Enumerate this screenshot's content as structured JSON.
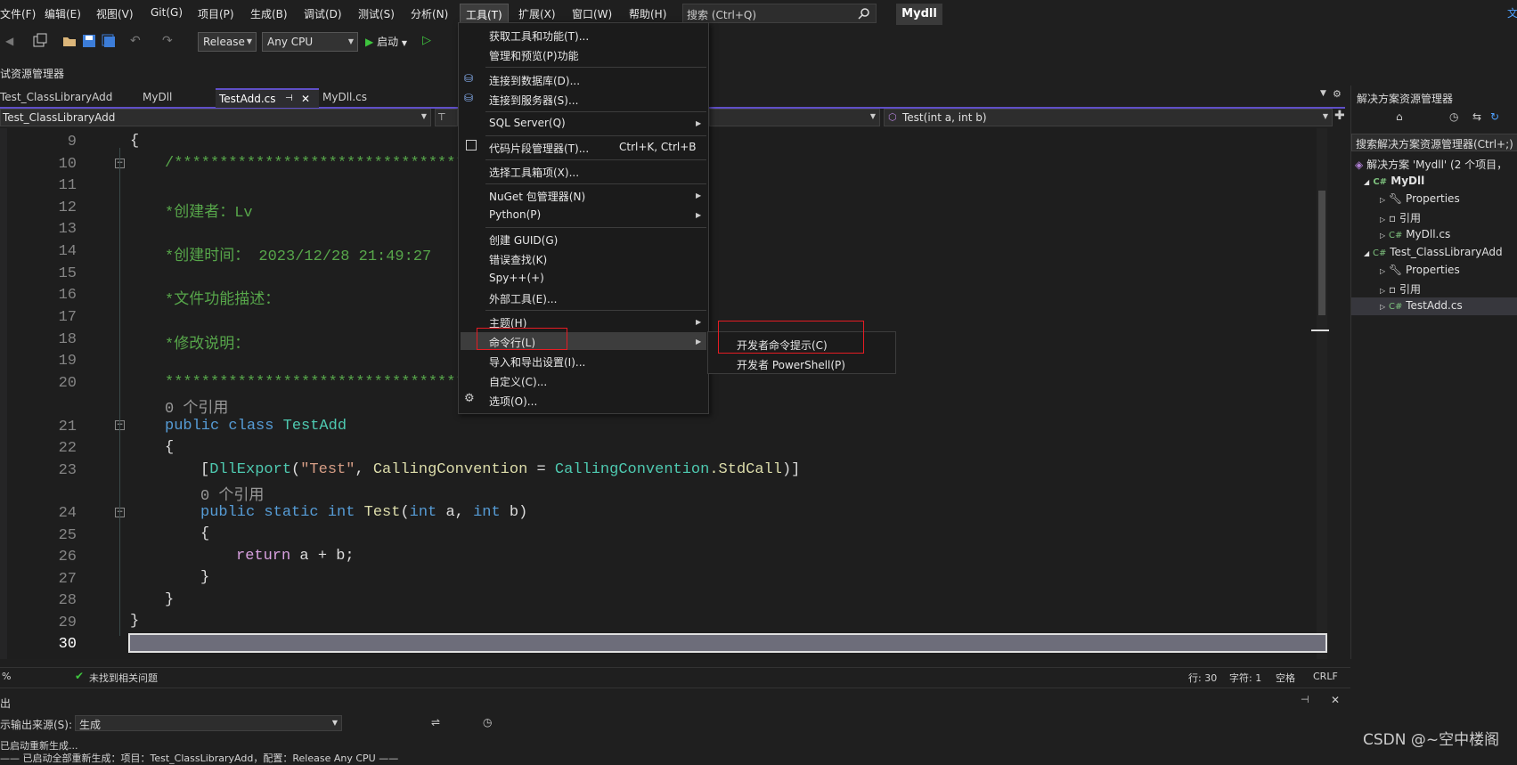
{
  "menubar": {
    "items": [
      "文件(F)",
      "编辑(E)",
      "视图(V)",
      "Git(G)",
      "项目(P)",
      "生成(B)",
      "调试(D)",
      "测试(S)",
      "分析(N)",
      "工具(T)",
      "扩展(X)",
      "窗口(W)",
      "帮助(H)"
    ],
    "search_placeholder": "搜索 (Ctrl+Q)",
    "solution_name": "Mydll"
  },
  "toolbar": {
    "configuration": "Release",
    "platform": "Any CPU",
    "start_label": "启动"
  },
  "left_panel_title": "试资源管理器",
  "tabs": {
    "items": [
      "Test_ClassLibraryAdd",
      "MyDll",
      "TestAdd.cs",
      "MyDll.cs"
    ],
    "active": "TestAdd.cs"
  },
  "nav": {
    "project": "Test_ClassLibraryAdd",
    "member": "Test(int a, int b)"
  },
  "editor": {
    "line_numbers": [
      "9",
      "10",
      "11",
      "12",
      "13",
      "14",
      "15",
      "16",
      "17",
      "18",
      "19",
      "20",
      "21",
      "22",
      "23",
      "24",
      "25",
      "26",
      "27",
      "28",
      "29",
      "30"
    ],
    "code": {
      "open_brace": "{",
      "comment_start": "/***********************************",
      "creator": "*创建者：Lv",
      "created_time": "*创建时间： 2023/12/28 21:49:27",
      "description": "*文件功能描述：",
      "modification": "*修改说明：",
      "comment_end": "************************************",
      "refs_0": "0 个引用",
      "class_kw": "public class ",
      "class_name": "TestAdd",
      "attr_open": "[",
      "attr_name": "DllExport",
      "attr_paren": "(",
      "attr_str": "\"Test\"",
      "attr_comma": ", ",
      "attr_param": "CallingConvention",
      "attr_eq": " = ",
      "attr_enum": "CallingConvention",
      "attr_member": ".StdCall",
      "attr_close": ")]",
      "refs_1": "0 个引用",
      "method_kw": "public static int ",
      "method_name": "Test",
      "method_params_open": "(",
      "int_kw1": "int",
      "param_a": " a, ",
      "int_kw2": "int",
      "param_b": " b)",
      "return_kw": "return",
      "return_expr": " a + b;",
      "close_brace": "}"
    }
  },
  "tools_menu": {
    "items": [
      {
        "label": "获取工具和功能(T)..."
      },
      {
        "label": "管理和预览(P)功能"
      },
      {
        "label": "连接到数据库(D)..."
      },
      {
        "label": "连接到服务器(S)..."
      },
      {
        "label": "SQL Server(Q)"
      },
      {
        "label": "代码片段管理器(T)...",
        "shortcut": "Ctrl+K, Ctrl+B"
      },
      {
        "label": "选择工具箱项(X)..."
      },
      {
        "label": "NuGet 包管理器(N)"
      },
      {
        "label": "Python(P)"
      },
      {
        "label": "创建 GUID(G)"
      },
      {
        "label": "错误查找(K)"
      },
      {
        "label": "Spy++(+)"
      },
      {
        "label": "外部工具(E)..."
      },
      {
        "label": "主题(H)"
      },
      {
        "label": "命令行(L)"
      },
      {
        "label": "导入和导出设置(I)..."
      },
      {
        "label": "自定义(C)..."
      },
      {
        "label": "选项(O)..."
      }
    ],
    "submenu": [
      "开发者命令提示(C)",
      "开发者 PowerShell(P)"
    ]
  },
  "solution_explorer": {
    "title": "解决方案资源管理器",
    "search_placeholder": "搜索解决方案资源管理器(Ctrl+;)",
    "solution": "解决方案 'Mydll' (2 个项目，",
    "nodes": [
      "MyDll",
      "Properties",
      "引用",
      "MyDll.cs",
      "Test_ClassLibraryAdd",
      "Properties",
      "引用",
      "TestAdd.cs"
    ]
  },
  "status": {
    "zoom": "%",
    "issues": "未找到相关问题",
    "line": "行: 30",
    "char": "字符: 1",
    "spaces": "空格",
    "eol": "CRLF"
  },
  "output": {
    "title": "出",
    "source_label": "示输出来源(S):",
    "source_value": "生成",
    "line1": "已启动重新生成...",
    "line2": "—— 已启动全部重新生成：项目：Test_ClassLibraryAdd，配置：Release Any CPU ——"
  },
  "watermark": "CSDN @~空中楼阁"
}
